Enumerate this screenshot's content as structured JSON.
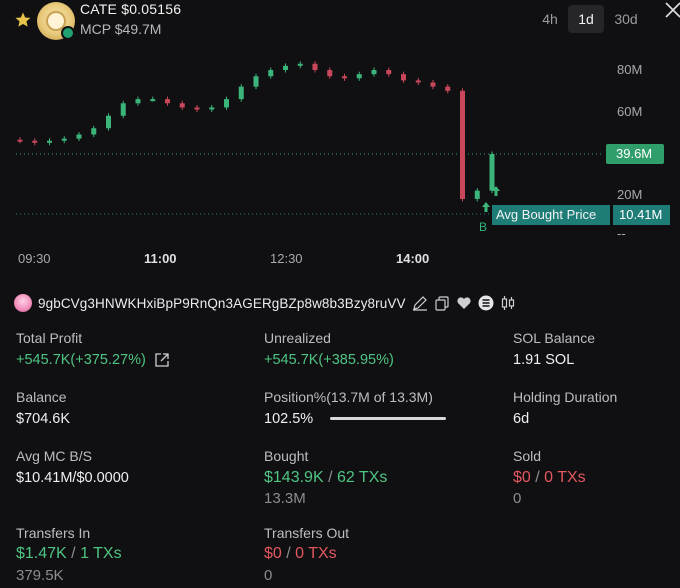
{
  "token": {
    "name": "CATE",
    "price": "$0.05156",
    "mcp": "MCP $49.7M"
  },
  "timeframes": [
    {
      "label": "4h",
      "active": false
    },
    {
      "label": "1d",
      "active": true
    },
    {
      "label": "30d",
      "active": false
    }
  ],
  "chart": {
    "y_labels": [
      "80M",
      "60M",
      "20M",
      "--"
    ],
    "x_labels": [
      "09:30",
      "11:00",
      "12:30",
      "14:00"
    ],
    "current_price_tag": "39.6M",
    "avg_bought_label": "Avg Bought Price",
    "avg_bought_value": "10.41M",
    "buy_marker": "B"
  },
  "chart_data": {
    "type": "candlestick",
    "x_tick_labels": [
      "09:30",
      "11:00",
      "12:30",
      "14:00"
    ],
    "y_tick_labels": [
      "80M",
      "60M",
      "20M"
    ],
    "candles_close": [
      46,
      45,
      46,
      47,
      49,
      52,
      58,
      64,
      66,
      66,
      64,
      62,
      61,
      62,
      66,
      72,
      77,
      80,
      82,
      83,
      80,
      77,
      76,
      78,
      80,
      78,
      75,
      74,
      72,
      70,
      18,
      22,
      39.6
    ],
    "avg_bought_price": 10.41,
    "current_price": 39.6
  },
  "wallet": {
    "address": "9gbCVg3HNWKHxiBpP9RnQn3AGERgBZp8w8b3Bzy8ruVV"
  },
  "stats": {
    "total_profit_label": "Total Profit",
    "total_profit_value": "+545.7K(+375.27%)",
    "unrealized_label": "Unrealized",
    "unrealized_value": "+545.7K(+385.95%)",
    "sol_balance_label": "SOL Balance",
    "sol_balance_value": "1.91 SOL",
    "balance_label": "Balance",
    "balance_value": "$704.6K",
    "position_label": "Position%(13.7M of 13.3M)",
    "position_value": "102.5%",
    "position_fill": 1.0,
    "holding_label": "Holding Duration",
    "holding_value": "6d",
    "avg_mc_label": "Avg MC B/S",
    "avg_mc_value": "$10.41M/$0.0000",
    "bought_label": "Bought",
    "bought_amount": "$143.9K",
    "bought_txs": "62 TXs",
    "bought_tokens": "13.3M",
    "sold_label": "Sold",
    "sold_amount": "$0",
    "sold_txs": "0 TXs",
    "sold_tokens": "0",
    "transfers_in_label": "Transfers In",
    "transfers_in_amount": "$1.47K",
    "transfers_in_txs": "1 TXs",
    "transfers_in_tokens": "379.5K",
    "transfers_out_label": "Transfers Out",
    "transfers_out_amount": "$0",
    "transfers_out_txs": "0 TXs",
    "transfers_out_tokens": "0",
    "separator": "/"
  },
  "colors": {
    "green": "#4fc483",
    "red": "#e3575f",
    "candle_up": "#3bb57a",
    "candle_down": "#c9475a",
    "avg_tag": "#1f7d78",
    "price_tag": "#2f9e6a"
  }
}
